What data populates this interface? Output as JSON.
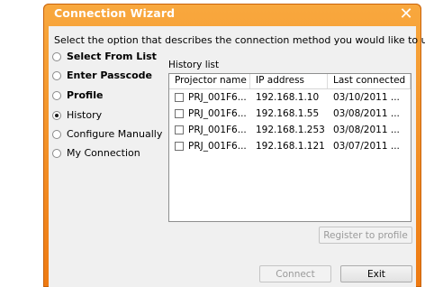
{
  "window": {
    "title": "Connection Wizard",
    "close_glyph": "✕"
  },
  "prompt": "Select the option that describes the connection method you would like to use:",
  "options": [
    {
      "label": "Select From List",
      "bold": true,
      "checked": false
    },
    {
      "label": "Enter Passcode",
      "bold": true,
      "checked": false
    },
    {
      "label": "Profile",
      "bold": true,
      "checked": false
    },
    {
      "label": "History",
      "bold": false,
      "checked": true
    },
    {
      "label": "Configure Manually",
      "bold": false,
      "checked": false
    },
    {
      "label": "My Connection",
      "bold": false,
      "checked": false
    }
  ],
  "history": {
    "label": "History list",
    "columns": [
      "Projector name",
      "IP address",
      "Last connected"
    ],
    "rows": [
      {
        "name": "PRJ_001F6...",
        "ip": "192.168.1.10",
        "last": "03/10/2011 ..."
      },
      {
        "name": "PRJ_001F6...",
        "ip": "192.168.1.55",
        "last": "03/08/2011 ..."
      },
      {
        "name": "PRJ_001F6...",
        "ip": "192.168.1.253",
        "last": "03/08/2011 ..."
      },
      {
        "name": "PRJ_001F6...",
        "ip": "192.168.1.121",
        "last": "03/07/2011 ..."
      }
    ]
  },
  "buttons": {
    "register": "Register to profile",
    "connect": "Connect",
    "exit": "Exit"
  }
}
